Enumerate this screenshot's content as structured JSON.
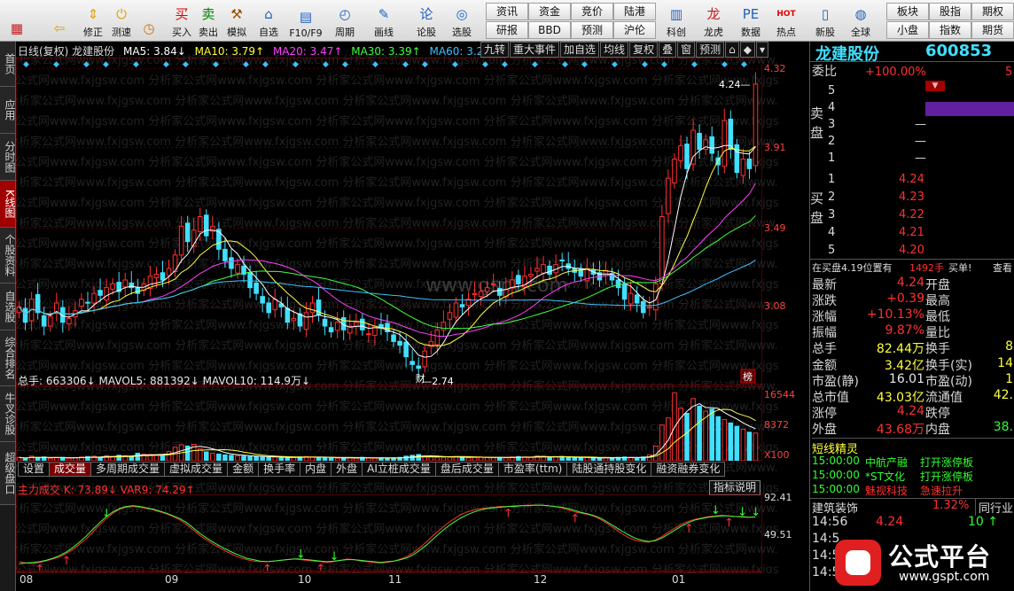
{
  "toolbar": {
    "icon_buttons": [
      {
        "label": "",
        "icon": "layout-grid-icon",
        "glyph": "▦",
        "color": "#c02020"
      },
      {
        "label": "",
        "icon": "back-arrow-icon",
        "glyph": "⇦",
        "color": "#e0a000"
      },
      {
        "label": "修正",
        "icon": "up-down-arrows-icon",
        "glyph": "⇕",
        "color": "#e0a000"
      },
      {
        "label": "测速",
        "icon": "power-icon",
        "glyph": "⏻",
        "color": "#e0a000"
      },
      {
        "label": "",
        "icon": "clock-icon",
        "glyph": "◷",
        "color": "#d07000"
      },
      {
        "label": "买入",
        "icon": "buy-icon",
        "glyph": "买",
        "color": "#e00000"
      },
      {
        "label": "卖出",
        "icon": "sell-icon",
        "glyph": "卖",
        "color": "#008000"
      },
      {
        "label": "模拟",
        "icon": "hammer-icon",
        "glyph": "⚒",
        "color": "#a05000"
      },
      {
        "label": "自选",
        "icon": "home-icon",
        "glyph": "⌂",
        "color": "#2060c0"
      },
      {
        "label": "F10/F9",
        "icon": "f10-icon",
        "glyph": "▤",
        "color": "#2060c0"
      },
      {
        "label": "周期",
        "icon": "period-clock-icon",
        "glyph": "◴",
        "color": "#2060c0"
      },
      {
        "label": "画线",
        "icon": "pencil-icon",
        "glyph": "✎",
        "color": "#2060c0"
      },
      {
        "label": "论股",
        "icon": "discuss-icon",
        "glyph": "论",
        "color": "#2060c0"
      },
      {
        "label": "选股",
        "icon": "screener-icon",
        "glyph": "◎",
        "color": "#2060c0"
      },
      {
        "label": "科创",
        "icon": "kechuang-icon",
        "glyph": "▥",
        "color": "#2060c0"
      },
      {
        "label": "龙虎",
        "icon": "dragon-tiger-icon",
        "glyph": "龙",
        "color": "#c02020"
      },
      {
        "label": "数据",
        "icon": "pe-icon",
        "glyph": "PE",
        "color": "#2060c0"
      },
      {
        "label": "热点",
        "icon": "hotspot-icon",
        "glyph": "HOT",
        "color": "#e00000"
      },
      {
        "label": "新股",
        "icon": "ipo-icon",
        "glyph": "▯",
        "color": "#2060c0"
      },
      {
        "label": "全球",
        "icon": "globe-icon",
        "glyph": "◍",
        "color": "#2060c0"
      }
    ],
    "text_buttons": [
      "资讯",
      "资金",
      "竞价",
      "陆港",
      "研报",
      "BBD",
      "预测",
      "沪伦",
      "板块",
      "股指",
      "期权",
      "小盘",
      "指数",
      "期货"
    ]
  },
  "left_tabs": [
    "首页",
    "应用",
    "分时图",
    "K线图",
    "个股资料",
    "自选股",
    "综合排名",
    "牛叉诊股",
    "超级盘口"
  ],
  "kline": {
    "title": "日线(复权) 龙建股份",
    "ma": [
      {
        "label": "MA5: 3.84↓",
        "color": "#ffffff"
      },
      {
        "label": "MA10: 3.79↑",
        "color": "#ffff40"
      },
      {
        "label": "MA20: 3.47↑",
        "color": "#ff40ff"
      },
      {
        "label": "MA30: 3.39↑",
        "color": "#40ff40"
      },
      {
        "label": "MA60: 3.21↑",
        "color": "#40c0ff"
      }
    ],
    "buttons": [
      "九转",
      "重大事件",
      "加自选",
      "均线",
      "复权",
      "叠",
      "窗",
      "预测"
    ],
    "price_axis": [
      "4.32",
      "3.91",
      "3.49",
      "3.08"
    ],
    "high_label": "4.24",
    "low_label": "2.74",
    "low_tag": "财",
    "bang_tag": "榜",
    "watermark_text": "分析家公式网www.fxjgsw.com",
    "watermark_center": "www.gspt.com"
  },
  "volume": {
    "title": "总手: 663306↓ MAVOL5: 881392↓ MAVOL10: 114.9万↓",
    "axis": [
      "16544",
      "8372",
      "X100"
    ]
  },
  "volume_tabs": [
    "设置",
    "成交量",
    "多周期成交量",
    "虚拟成交量",
    "金额",
    "换手率",
    "内盘",
    "外盘",
    "AI立桩成交量",
    "盘后成交量",
    "市盈率(ttm)",
    "陆股通持股变化",
    "融资融券变化"
  ],
  "indicator": {
    "title": "主力成交 K: 73.89↓ VAR9: 74.29↑",
    "help_button": "指标说明",
    "axis": [
      "92.41",
      "49.51"
    ]
  },
  "x_axis": [
    "08",
    "09",
    "10",
    "11",
    "12",
    "01"
  ],
  "quote": {
    "name": "龙建股份",
    "code": "600853",
    "weibi_label": "委比",
    "weibi_value": "+100.00%",
    "sell_side_label": [
      "卖",
      "盘"
    ],
    "buy_side_label": [
      "买",
      "盘"
    ],
    "sell_levels": [
      {
        "n": "5",
        "price": "",
        "vol": ""
      },
      {
        "n": "4",
        "price": "",
        "vol": ""
      },
      {
        "n": "3",
        "price": "—",
        "vol": ""
      },
      {
        "n": "2",
        "price": "—",
        "vol": ""
      },
      {
        "n": "1",
        "price": "—",
        "vol": ""
      }
    ],
    "buy_levels": [
      {
        "n": "1",
        "price": "4.24"
      },
      {
        "n": "2",
        "price": "4.23"
      },
      {
        "n": "3",
        "price": "4.22"
      },
      {
        "n": "4",
        "price": "4.21"
      },
      {
        "n": "5",
        "price": "4.20"
      }
    ],
    "bid_note": "在买盘4.19位置有",
    "bid_volume": "1492手",
    "bid_action": "买单!",
    "bid_query": "查看",
    "stats": [
      {
        "l": "最新",
        "v": "4.24",
        "c": "red",
        "r": "开盘"
      },
      {
        "l": "涨跌",
        "v": "+0.39",
        "c": "red",
        "r": "最高"
      },
      {
        "l": "涨幅",
        "v": "+10.13%",
        "c": "red",
        "r": "最低"
      },
      {
        "l": "振幅",
        "v": "9.87%",
        "c": "red",
        "r": "量比"
      },
      {
        "l": "总手",
        "v": "82.44万",
        "c": "yellow",
        "r": "换手"
      },
      {
        "l": "金额",
        "v": "3.42亿",
        "c": "yellow",
        "r": "换手(实)"
      },
      {
        "l": "市盈(静)",
        "v": "16.01",
        "c": "white",
        "r": "市盈(动)"
      },
      {
        "l": "总市值",
        "v": "43.03亿",
        "c": "yellow",
        "r": "流通值"
      },
      {
        "l": "涨停",
        "v": "4.24",
        "c": "red",
        "r": "跌停"
      },
      {
        "l": "外盘",
        "v": "43.68万",
        "c": "red",
        "r": "内盘"
      }
    ],
    "stats_right_values": [
      "",
      "",
      "",
      "",
      "8",
      "14",
      "1",
      "42.",
      "",
      ""
    ],
    "inner_value": "38."
  },
  "elves": {
    "title": "短线精灵",
    "rows": [
      {
        "time": "15:00:00",
        "name": "中航产融",
        "event": "打开涨停板"
      },
      {
        "time": "15:00:00",
        "name": "*ST文化",
        "event": "打开涨停板"
      },
      {
        "time": "15:00:00",
        "name": "魅视科技",
        "event": "急速拉升"
      }
    ]
  },
  "sector": {
    "name": "建筑装饰",
    "change": "1.32%",
    "rank_label": "同行业"
  },
  "ticks": [
    {
      "time": "14:56",
      "price": "4.24",
      "vol": "10"
    },
    {
      "time": "14:5",
      "": "",
      "price": "",
      "vol": ""
    },
    {
      "time": "14:5",
      "price": "",
      "vol": ""
    },
    {
      "time": "14:5",
      "price": "",
      "vol": ""
    }
  ],
  "logo": {
    "text": "公式平台",
    "url": "www.gspt.com"
  },
  "chart_data": {
    "type": "candlestick",
    "price_axis": [
      4.32,
      3.91,
      3.49,
      3.08
    ],
    "volume_axis": [
      16544,
      8372
    ],
    "indicator_axis": [
      92.41,
      49.51
    ],
    "high": 4.24,
    "low": 2.74,
    "last": {
      "MA5": 3.84,
      "MA10": 3.79,
      "MA20": 3.47,
      "MA30": 3.39,
      "MA60": 3.21
    },
    "close": [
      3.08,
      3.0,
      3.12,
      3.05,
      2.98,
      3.03,
      3.1,
      3.0,
      3.02,
      3.06,
      3.12,
      3.1,
      3.15,
      3.14,
      3.18,
      3.2,
      3.16,
      3.22,
      3.18,
      3.15,
      3.2,
      3.24,
      3.25,
      3.22,
      3.28,
      3.35,
      3.5,
      3.42,
      3.48,
      3.55,
      3.45,
      3.5,
      3.38,
      3.32,
      3.28,
      3.3,
      3.25,
      3.18,
      3.15,
      3.1,
      3.05,
      3.12,
      3.08,
      3.0,
      3.02,
      2.98,
      3.05,
      3.1,
      3.04,
      2.98,
      2.95,
      3.0,
      2.96,
      2.98,
      3.0,
      2.96,
      2.94,
      2.98,
      2.97,
      2.95,
      2.9,
      2.88,
      2.82,
      2.78,
      2.76,
      2.85,
      2.9,
      2.96,
      3.0,
      3.05,
      3.1,
      3.08,
      3.12,
      3.15,
      3.16,
      3.18,
      3.2,
      3.14,
      3.17,
      3.22,
      3.2,
      3.24,
      3.25,
      3.28,
      3.3,
      3.25,
      3.3,
      3.32,
      3.28,
      3.26,
      3.24,
      3.28,
      3.25,
      3.22,
      3.27,
      3.22,
      3.18,
      3.12,
      3.15,
      3.1,
      3.05,
      3.08,
      3.2,
      3.55,
      3.75,
      3.85,
      3.92,
      3.8,
      4.0,
      3.9,
      3.95,
      3.88,
      3.82,
      4.05,
      3.9,
      3.78,
      3.85,
      3.8,
      4.24
    ],
    "volume": [
      0.8,
      0.5,
      1.1,
      0.7,
      0.9,
      0.6,
      0.7,
      0.8,
      0.6,
      0.7,
      0.9,
      1.0,
      1.1,
      0.8,
      1.2,
      1.0,
      1.3,
      1.2,
      1.0,
      1.8,
      1.6,
      1.5,
      1.4,
      1.3,
      2.2,
      3.2,
      3.8,
      3.5,
      3.9,
      2.8,
      2.1,
      1.8,
      1.6,
      1.4,
      1.3,
      1.2,
      1.1,
      1.0,
      1.0,
      0.9,
      0.8,
      0.9,
      0.8,
      0.7,
      0.8,
      0.9,
      1.0,
      0.9,
      0.8,
      0.7,
      0.7,
      0.6,
      0.7,
      0.7,
      0.6,
      0.8,
      0.7,
      0.6,
      0.7,
      0.6,
      0.7,
      0.8,
      1.1,
      1.3,
      1.5,
      1.0,
      0.9,
      0.8,
      0.8,
      0.9,
      1.0,
      0.8,
      0.7,
      0.8,
      0.9,
      0.8,
      0.7,
      0.8,
      0.7,
      0.9,
      1.0,
      0.9,
      0.8,
      1.2,
      1.1,
      0.8,
      0.9,
      1.0,
      0.8,
      0.7,
      0.7,
      0.8,
      0.7,
      0.6,
      0.7,
      0.7,
      0.8,
      0.9,
      0.8,
      0.7,
      0.9,
      1.4,
      3.5,
      8.5,
      10.2,
      16.2,
      12.5,
      11.3,
      14.8,
      13.0,
      11.8,
      12.3,
      10.5,
      9.8,
      9.0,
      8.2,
      7.5,
      6.8,
      6.6
    ],
    "indicator_K": [
      8,
      6,
      5,
      7,
      9,
      12,
      15,
      20,
      26,
      34,
      42,
      52,
      63,
      72,
      80,
      86,
      89,
      90,
      89,
      87,
      85,
      82,
      79,
      75,
      70,
      63,
      55,
      47,
      40,
      34,
      28,
      23,
      18,
      14,
      11,
      9,
      8,
      8,
      9,
      10,
      11,
      12,
      11,
      10,
      9,
      8,
      7,
      8,
      10,
      12,
      11,
      9,
      8,
      7,
      6,
      7,
      9,
      12,
      16,
      22,
      30,
      39,
      48,
      57,
      65,
      72,
      78,
      82,
      85,
      87,
      88,
      89,
      90,
      90,
      91,
      91,
      92,
      92,
      92,
      91,
      90,
      88,
      85,
      82,
      80,
      78,
      75,
      70,
      64,
      57,
      50,
      44,
      40,
      38,
      37,
      40,
      45,
      52,
      58,
      64,
      68,
      71,
      73,
      75,
      76,
      77,
      76,
      75,
      74,
      74,
      73.89
    ],
    "indicator_VAR9": [
      5,
      6,
      7,
      8,
      10,
      13,
      17,
      22,
      29,
      37,
      46,
      56,
      66,
      75,
      82,
      87,
      90,
      91,
      90,
      88,
      86,
      83,
      80,
      76,
      72,
      66,
      58,
      50,
      43,
      37,
      31,
      26,
      21,
      17,
      13,
      11,
      9,
      8,
      9,
      10,
      11,
      12,
      12,
      11,
      10,
      9,
      8,
      9,
      10,
      11,
      11,
      10,
      9,
      8,
      7,
      8,
      9,
      11,
      14,
      19,
      26,
      34,
      43,
      52,
      60,
      67,
      73,
      78,
      82,
      85,
      87,
      88,
      89,
      90,
      90,
      91,
      91,
      92,
      92,
      91,
      90,
      89,
      87,
      84,
      81,
      79,
      76,
      72,
      66,
      60,
      54,
      48,
      43,
      40,
      38,
      39,
      43,
      49,
      55,
      61,
      66,
      70,
      72,
      74,
      75,
      76,
      76,
      75,
      75,
      74,
      74.29
    ]
  }
}
